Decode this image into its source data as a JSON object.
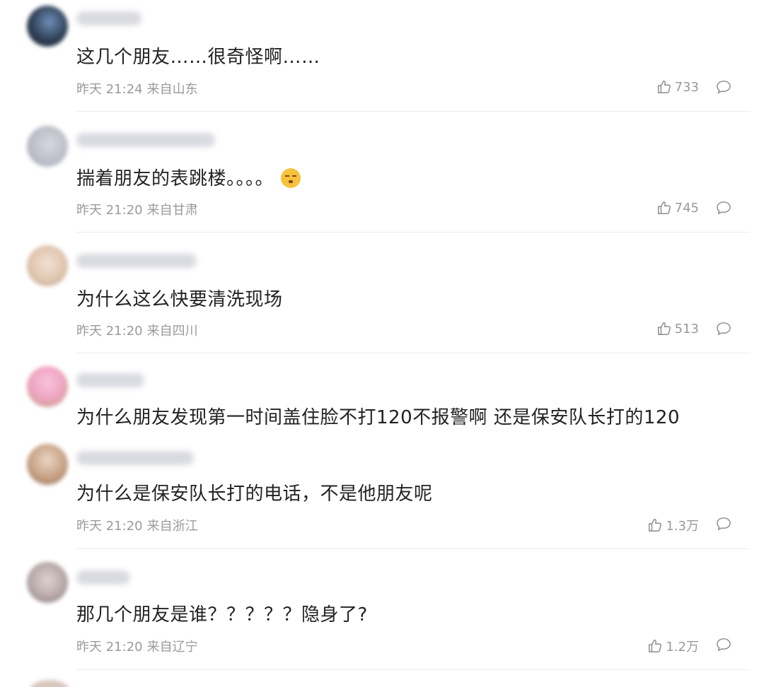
{
  "comments": [
    {
      "text": "这几个朋友……很奇怪啊……",
      "time": "昨天 21:24",
      "location": "来自山东",
      "likes": "733",
      "avatar_color": "#2f3f55"
    },
    {
      "text": "揣着朋友的表跳楼。。。。",
      "emoji": "unamused-face-emoji",
      "time": "昨天 21:20",
      "location": "来自甘肃",
      "likes": "745",
      "avatar_color": "#b9bcc6"
    },
    {
      "text": "为什么这么快要清洗现场",
      "time": "昨天 21:20",
      "location": "来自四川",
      "likes": "513",
      "avatar_color": "#e0c6b0"
    },
    {
      "text": "为什么朋友发现第一时间盖住脸不打120不报警啊 还是保安队长打的120",
      "avatar_color": "#f0a7c5"
    },
    {
      "text": "为什么是保安队长打的电话，不是他朋友呢",
      "time": "昨天 21:20",
      "location": "来自浙江",
      "likes": "1.3万",
      "avatar_color": "#c7a184"
    },
    {
      "text": "那几个朋友是谁？？？？？隐身了?",
      "time": "昨天 21:20",
      "location": "来自辽宁",
      "likes": "1.2万",
      "avatar_color": "#b8a9a8"
    }
  ],
  "icons": {
    "like": "thumbs-up-icon",
    "reply": "comment-bubble-icon"
  }
}
